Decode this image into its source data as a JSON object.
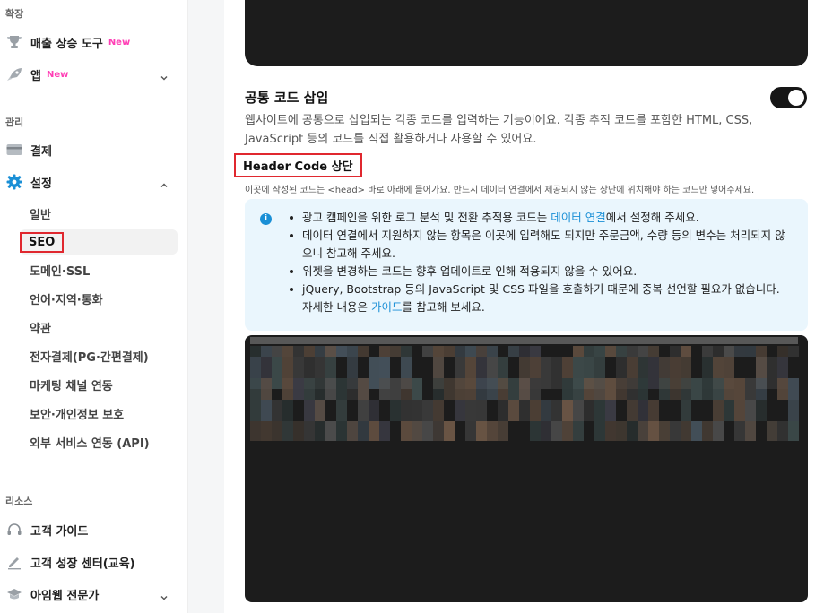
{
  "sidebar": {
    "sections": {
      "extend": "확장",
      "manage": "관리",
      "resources": "리소스"
    },
    "items": {
      "sales_tool": {
        "label": "매출 상승 도구",
        "badge": "New"
      },
      "apps": {
        "label": "앱",
        "badge": "New"
      },
      "payment": {
        "label": "결제"
      },
      "settings": {
        "label": "설정"
      },
      "guide": {
        "label": "고객 가이드"
      },
      "growth": {
        "label": "고객 성장 센터(교육)"
      },
      "expert": {
        "label": "아임웹 전문가"
      }
    },
    "settings_sub": [
      "일반",
      "SEO",
      "도메인·SSL",
      "언어·지역·통화",
      "약관",
      "전자결제(PG·간편결제)",
      "마케팅 채널 연동",
      "보안·개인정보 보호",
      "외부 서비스 연동 (API)"
    ],
    "active_sub": "SEO"
  },
  "main": {
    "section_title": "공통 코드 삽입",
    "toggle_on": true,
    "description": "웹사이트에 공통으로 삽입되는 각종 코드를 입력하는 기능이에요. 각종 추적 코드를 포함한 HTML, CSS, JavaScript 등의 코드를 직접 활용하거나 사용할 수 있어요.",
    "header_code_title": "Header Code 상단",
    "header_code_note": "이곳에 작성된 코드는 <head> 바로 아래에 들어가요. 반드시 데이터 연결에서 제공되지 않는 상단에 위치해야 하는 코드만 넣어주세요.",
    "info": {
      "b1_pre": "광고 캠페인을 위한 로그 분석 및 전환 추적용 코드는 ",
      "b1_link": "데이터 연결",
      "b1_post": "에서 설정해 주세요.",
      "b2": "데이터 연결에서 지원하지 않는 항목은 이곳에 입력해도 되지만 주문금액, 수량 등의 변수는 처리되지 않으니 참고해 주세요.",
      "b3": "위젯을 변경하는 코드는 향후 업데이트로 인해 적용되지 않을 수 있어요.",
      "b4_pre": "jQuery, Bootstrap 등의 JavaScript 및 CSS 파일을 호출하기 때문에 중복 선언할 필요가 없습니다. 자세한 내용은 ",
      "b4_link": "가이드",
      "b4_post": "를 참고해 보세요."
    }
  },
  "colors": {
    "accent_link": "#1a8fd6",
    "badge_new": "#ff3eb5",
    "highlight_box": "#e0282f",
    "info_bg": "#eaf6fd",
    "code_bg": "#1c1c1c"
  }
}
